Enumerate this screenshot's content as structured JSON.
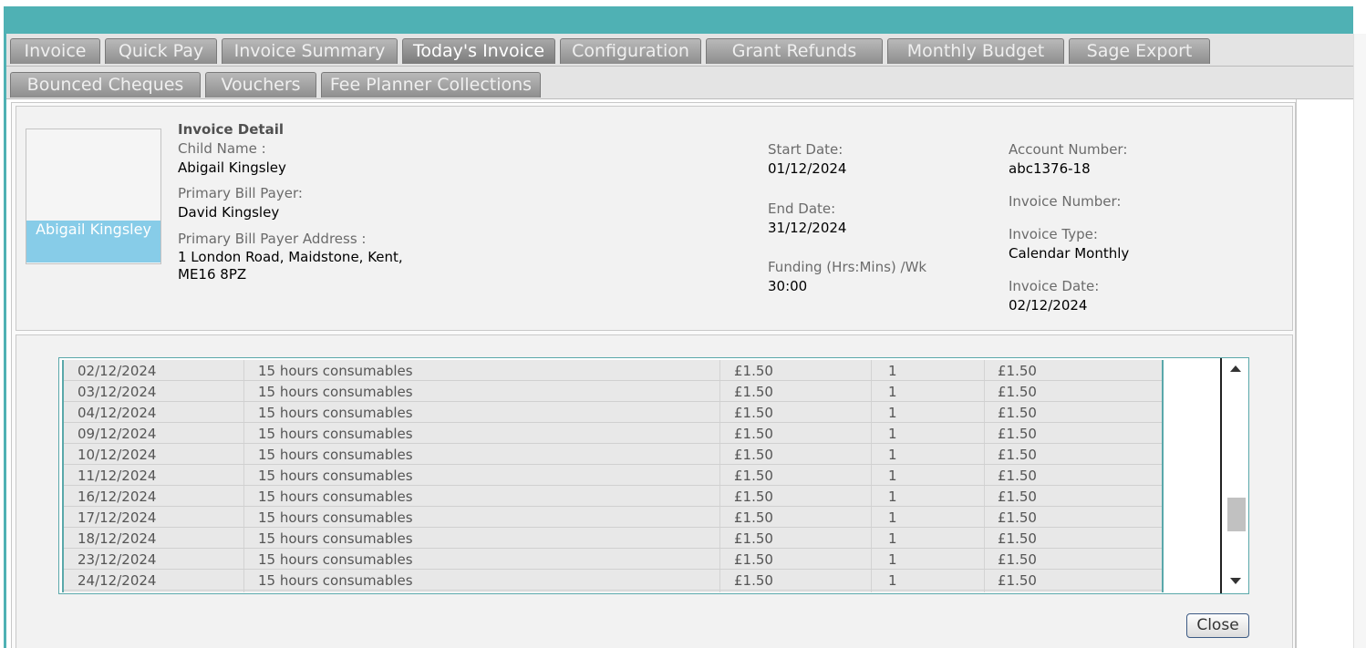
{
  "tabs_row1": [
    "Invoice",
    "Quick Pay",
    "Invoice Summary",
    "Today's Invoice",
    "Configuration",
    "Grant Refunds",
    "Monthly Budget",
    "Sage Export"
  ],
  "tabs_row2": [
    "Bounced Cheques",
    "Vouchers",
    "Fee Planner Collections"
  ],
  "active_tab": "Today's Invoice",
  "detail": {
    "heading": "Invoice Detail",
    "photo_name": "Abigail Kingsley",
    "child_name_label": "Child Name :",
    "child_name": "Abigail Kingsley",
    "payer_label": "Primary Bill Payer:",
    "payer": "David Kingsley",
    "address_label": "Primary Bill Payer Address :",
    "address_line1": "1 London Road, Maidstone, Kent,",
    "address_line2": "ME16 8PZ",
    "start_label": "Start Date:",
    "start": "01/12/2024",
    "end_label": "End Date:",
    "end": "31/12/2024",
    "funding_label": "Funding (Hrs:Mins) /Wk",
    "funding": "30:00",
    "account_label": "Account Number:",
    "account": "abc1376-18",
    "invoice_number_label": "Invoice Number:",
    "invoice_type_label": "Invoice Type:",
    "invoice_type": "Calendar Monthly",
    "invoice_date_label": "Invoice Date:",
    "invoice_date": "02/12/2024"
  },
  "rows": [
    [
      "02/12/2024",
      "15 hours consumables",
      "£1.50",
      "1",
      "£1.50"
    ],
    [
      "03/12/2024",
      "15 hours consumables",
      "£1.50",
      "1",
      "£1.50"
    ],
    [
      "04/12/2024",
      "15 hours consumables",
      "£1.50",
      "1",
      "£1.50"
    ],
    [
      "09/12/2024",
      "15 hours consumables",
      "£1.50",
      "1",
      "£1.50"
    ],
    [
      "10/12/2024",
      "15 hours consumables",
      "£1.50",
      "1",
      "£1.50"
    ],
    [
      "11/12/2024",
      "15 hours consumables",
      "£1.50",
      "1",
      "£1.50"
    ],
    [
      "16/12/2024",
      "15 hours consumables",
      "£1.50",
      "1",
      "£1.50"
    ],
    [
      "17/12/2024",
      "15 hours consumables",
      "£1.50",
      "1",
      "£1.50"
    ],
    [
      "18/12/2024",
      "15 hours consumables",
      "£1.50",
      "1",
      "£1.50"
    ],
    [
      "23/12/2024",
      "15 hours consumables",
      "£1.50",
      "1",
      "£1.50"
    ],
    [
      "24/12/2024",
      "15 hours consumables",
      "£1.50",
      "1",
      "£1.50"
    ]
  ],
  "close_label": "Close",
  "colors": {
    "accent": "#4fb1b4",
    "photo_bg": "#87cce8",
    "button_border": "#3c5a84"
  }
}
